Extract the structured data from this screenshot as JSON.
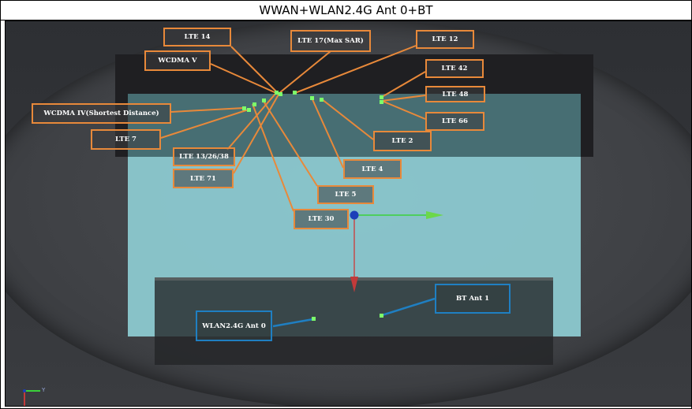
{
  "title": "WWAN+WLAN2.4G Ant 0+BT",
  "colors": {
    "wwan_label_border": "#e8893a",
    "wwan_leader": "#e8893a",
    "wlan_bt_label_border": "#1f7fc2",
    "wlan_bt_leader": "#1f7fc2",
    "antenna_point": "#7dff6a"
  },
  "labels": {
    "lte14": "LTE 14",
    "lte17": "LTE 17(Max SAR)",
    "lte12": "LTE 12",
    "wcdma_v": "WCDMA V",
    "lte42": "LTE 42",
    "lte48": "LTE 48",
    "wcdma_iv": "WCDMA IV(Shortest Distance)",
    "lte66": "LTE 66",
    "lte7": "LTE 7",
    "lte2": "LTE 2",
    "lte13_26_38": "LTE 13/26/38",
    "lte4": "LTE 4",
    "lte71": "LTE 71",
    "lte5": "LTE 5",
    "lte30": "LTE 30",
    "bt_ant1": "BT Ant 1",
    "wlan_ant0": "WLAN2.4G Ant 0"
  },
  "axis_indicator": {
    "y_label": "Y"
  }
}
